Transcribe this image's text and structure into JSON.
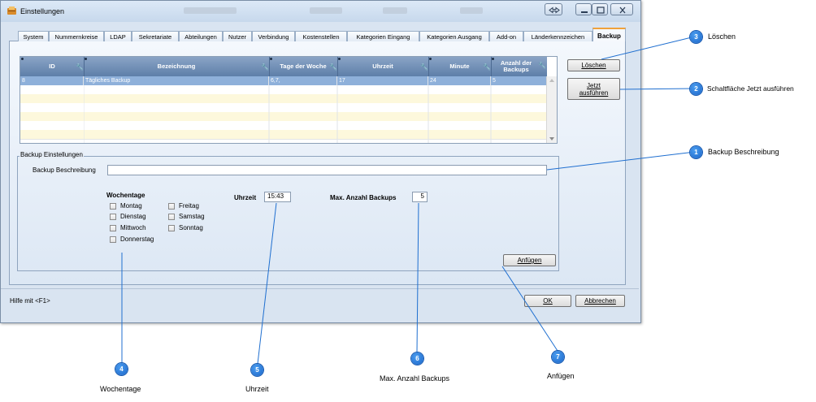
{
  "window": {
    "title": "Einstellungen",
    "status_hint": "Hilfe mit <F1>"
  },
  "tabs": [
    {
      "label": "System"
    },
    {
      "label": "Nummernkreise"
    },
    {
      "label": "LDAP"
    },
    {
      "label": "Sekretariate"
    },
    {
      "label": "Abteilungen"
    },
    {
      "label": "Nutzer"
    },
    {
      "label": "Verbindung"
    },
    {
      "label": "Kostenstellen"
    },
    {
      "label": "Kategorien Eingang"
    },
    {
      "label": "Kategorien Ausgang"
    },
    {
      "label": "Add-on"
    },
    {
      "label": "Länderkennzeichen"
    },
    {
      "label": "Backup",
      "active": true
    }
  ],
  "grid": {
    "columns": [
      "ID",
      "Bezeichnung",
      "Tage der Woche",
      "Uhrzeit",
      "Minute",
      "Anzahl der Backups"
    ],
    "rows": [
      [
        "8",
        "Tägliches Backup",
        "6,7,",
        "17",
        "24",
        "5"
      ]
    ]
  },
  "buttons": {
    "delete": "Löschen",
    "run_now": "Jetzt ausführen",
    "append": "Anfügen",
    "ok": "OK",
    "cancel": "Abbrechen"
  },
  "backup_settings": {
    "group_title": "Backup Einstellungen",
    "description_label": "Backup Beschreibung",
    "description_value": "",
    "weekdays_title": "Wochentage",
    "weekdays": [
      "Montag",
      "Dienstag",
      "Mittwoch",
      "Donnerstag",
      "Freitag",
      "Samstag",
      "Sonntag"
    ],
    "time_label": "Uhrzeit",
    "time_value": "15:43",
    "max_backups_label": "Max. Anzahl Backups",
    "max_backups_value": "5"
  },
  "annotations": [
    {
      "num": "1",
      "text": "Backup Beschreibung"
    },
    {
      "num": "2",
      "text": "Schaltfläche Jetzt ausführen"
    },
    {
      "num": "3",
      "text": "Löschen"
    },
    {
      "num": "4",
      "text": "Wochentage"
    },
    {
      "num": "5",
      "text": "Uhrzeit"
    },
    {
      "num": "6",
      "text": "Max. Anzahl Backups"
    },
    {
      "num": "7",
      "text": "Anfügen"
    }
  ],
  "colors": {
    "accent_tab": "#f0a23a",
    "grid_header": "#5e7fa9",
    "selected_row": "#8eb0da",
    "alt_row": "#fdf8dc",
    "badge": "#1a64c8"
  }
}
